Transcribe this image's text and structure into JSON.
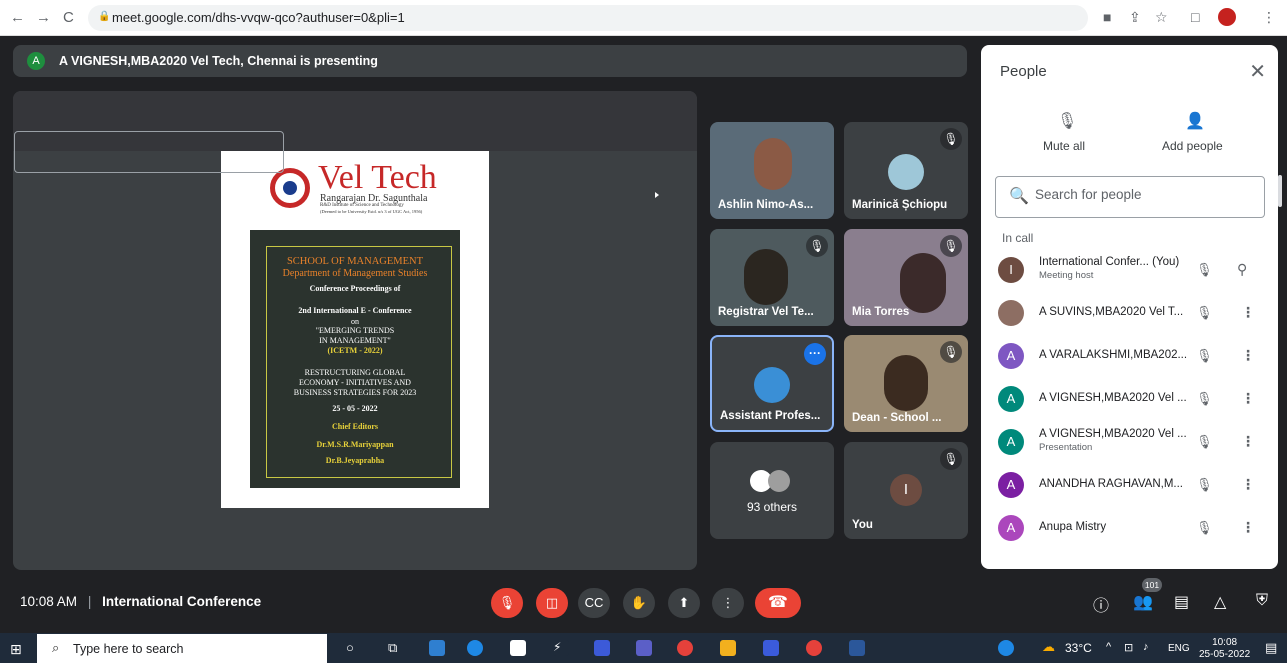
{
  "browser": {
    "url": "meet.google.com/dhs-vvqw-qco?authuser=0&pli=1",
    "profile_initial": ""
  },
  "banner": {
    "avatar": "A",
    "text": "A VIGNESH,MBA2020 Vel Tech, Chennai is presenting"
  },
  "slide": {
    "title": "Vel Tech",
    "sub1": "Rangarajan Dr. Sagunthala",
    "sub2": "R&D Institute of Science and Technology",
    "sub3": "(Deemed to be University Estd. u/s 3 of UGC Act, 1956)",
    "school": "SCHOOL OF MANAGEMENT",
    "dept": "Department of Management Studies",
    "proc": "Conference Proceedings of",
    "conf": "2nd International E - Conference",
    "on": "on",
    "theme1": "\"EMERGING TRENDS",
    "theme2": "IN MANAGEMENT\"",
    "icetm": "(ICETM - 2022)",
    "r1": "RESTRUCTURING GLOBAL",
    "r2": "ECONOMY - INITIATIVES AND",
    "r3": "BUSINESS STRATEGIES FOR 2023",
    "date": "25 - 05 - 2022",
    "editors": "Chief Editors",
    "e1": "Dr.M.S.R.Mariyappan",
    "e2": "Dr.B.Jeyaprabha"
  },
  "tiles": {
    "t1": "Ashlin Nimo-As...",
    "t2": "Marinică Șchiopu",
    "t3": "Registrar Vel Te...",
    "t4": "Mia Torres",
    "t5": "Assistant Profes...",
    "t6": "Dean - School ...",
    "t7": "93 others",
    "t8": "You",
    "t8_avatar": "I"
  },
  "panel": {
    "title": "People",
    "mute_all": "Mute all",
    "add_people": "Add people",
    "search_placeholder": "Search for people",
    "in_call": "In call",
    "people": [
      {
        "avatar": "I",
        "name": "International Confer... (You)",
        "sub": "Meeting host",
        "color": "#6d4c41"
      },
      {
        "avatar": "",
        "name": "A SUVINS,MBA2020 Vel T...",
        "sub": "",
        "color": "#8d6e63"
      },
      {
        "avatar": "A",
        "name": "A VARALAKSHMI,MBA202...",
        "sub": "",
        "color": "#7e57c2"
      },
      {
        "avatar": "A",
        "name": "A VIGNESH,MBA2020 Vel ...",
        "sub": "",
        "color": "#00897b"
      },
      {
        "avatar": "A",
        "name": "A VIGNESH,MBA2020 Vel ...",
        "sub": "Presentation",
        "color": "#00897b"
      },
      {
        "avatar": "A",
        "name": "ANANDHA RAGHAVAN,M...",
        "sub": "",
        "color": "#7b1fa2"
      },
      {
        "avatar": "A",
        "name": "Anupa Mistry",
        "sub": "",
        "color": "#ab47bc"
      }
    ]
  },
  "bottom": {
    "time": "10:08 AM",
    "separator": "|",
    "meeting": "International Conference",
    "participants": "101"
  },
  "taskbar": {
    "search": "Type here to search",
    "temp": "33°C",
    "lang": "ENG",
    "time": "10:08",
    "date": "25-05-2022"
  }
}
